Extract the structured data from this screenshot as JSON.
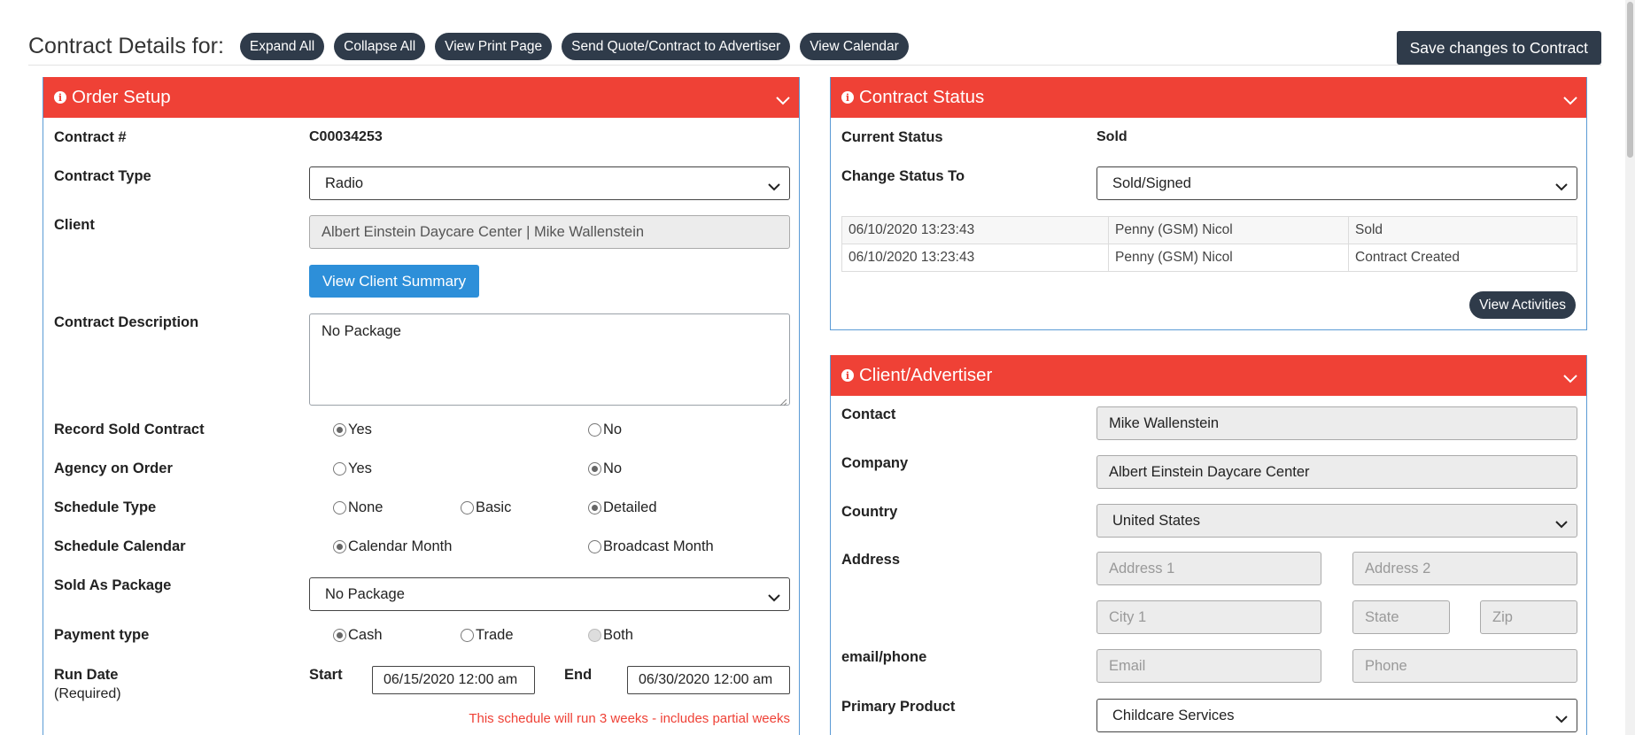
{
  "header": {
    "title": "Contract Details for:",
    "buttons": {
      "expand_all": "Expand All",
      "collapse_all": "Collapse All",
      "view_print_page": "View Print Page",
      "send_quote": "Send Quote/Contract to Advertiser",
      "view_calendar": "View Calendar"
    },
    "save_label": "Save changes to Contract"
  },
  "order_setup": {
    "title": "Order Setup",
    "contract_number_label": "Contract #",
    "contract_number": "C00034253",
    "contract_type_label": "Contract Type",
    "contract_type": "Radio",
    "client_label": "Client",
    "client": "Albert Einstein Daycare Center | Mike Wallenstein",
    "view_client_summary": "View Client Summary",
    "description_label": "Contract Description",
    "description": "No Package",
    "record_sold_label": "Record Sold Contract",
    "agency_label": "Agency on Order",
    "schedule_type_label": "Schedule Type",
    "schedule_calendar_label": "Schedule Calendar",
    "sold_as_package_label": "Sold As Package",
    "sold_as_package": "No Package",
    "payment_type_label": "Payment type",
    "run_date_label": "Run Date",
    "run_date_required": "(Required)",
    "start_label": "Start",
    "start_value": "06/15/2020 12:00 am",
    "end_label": "End",
    "end_value": "06/30/2020 12:00 am",
    "schedule_note": "This schedule will run 3 weeks - includes partial weeks",
    "options": {
      "yes": "Yes",
      "no": "No",
      "none": "None",
      "basic": "Basic",
      "detailed": "Detailed",
      "calendar_month": "Calendar Month",
      "broadcast_month": "Broadcast Month",
      "cash": "Cash",
      "trade": "Trade",
      "both": "Both"
    }
  },
  "contract_status": {
    "title": "Contract Status",
    "current_status_label": "Current Status",
    "current_status": "Sold",
    "change_status_label": "Change Status To",
    "change_status": "Sold/Signed",
    "history": [
      {
        "date": "06/10/2020 13:23:43",
        "user": "Penny (GSM) Nicol",
        "status": "Sold"
      },
      {
        "date": "06/10/2020 13:23:43",
        "user": "Penny (GSM) Nicol",
        "status": "Contract Created"
      }
    ],
    "view_activities": "View Activities"
  },
  "client_advertiser": {
    "title": "Client/Advertiser",
    "contact_label": "Contact",
    "contact": "Mike Wallenstein",
    "company_label": "Company",
    "company": "Albert Einstein Daycare Center",
    "country_label": "Country",
    "country": "United States",
    "address_label": "Address",
    "address1_placeholder": "Address 1",
    "address2_placeholder": "Address 2",
    "city_placeholder": "City 1",
    "state_placeholder": "State",
    "zip_placeholder": "Zip",
    "email_phone_label": "email/phone",
    "email_placeholder": "Email",
    "phone_placeholder": "Phone",
    "primary_product_label": "Primary Product",
    "primary_product": "Childcare Services"
  },
  "colors": {
    "panel_header": "#ef4136",
    "dark_button": "#2f3b4a",
    "blue_button": "#2d8fd9",
    "panel_border": "#5b9bd5"
  }
}
